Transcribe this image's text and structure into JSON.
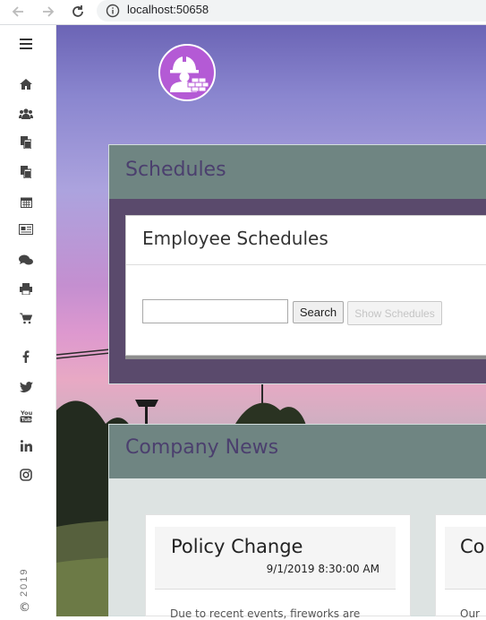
{
  "browser": {
    "url": "localhost:50658"
  },
  "sidebar": {
    "year": "2019",
    "copyright": "©",
    "icons": [
      "menu-icon",
      "home-icon",
      "users-icon",
      "copy-icon",
      "files-icon",
      "calendar-icon",
      "newspaper-icon",
      "comments-icon",
      "print-icon",
      "cart-icon",
      "facebook-icon",
      "twitter-icon",
      "youtube-icon",
      "linkedin-icon",
      "instagram-icon"
    ]
  },
  "schedules": {
    "title": "Schedules",
    "card_title": "Employee Schedules",
    "search_value": "",
    "search_button": "Search",
    "show_button": "Show Schedules"
  },
  "news": {
    "title": "Company News",
    "items": [
      {
        "title": "Policy Change",
        "date": "9/1/2019 8:30:00 AM",
        "body": "Due to recent events, fireworks are"
      },
      {
        "title": "Con",
        "body": "Our"
      }
    ]
  },
  "colors": {
    "panel_header": "#6f8582",
    "panel_title": "#4b3f6e",
    "logo": "#b45ad5"
  }
}
